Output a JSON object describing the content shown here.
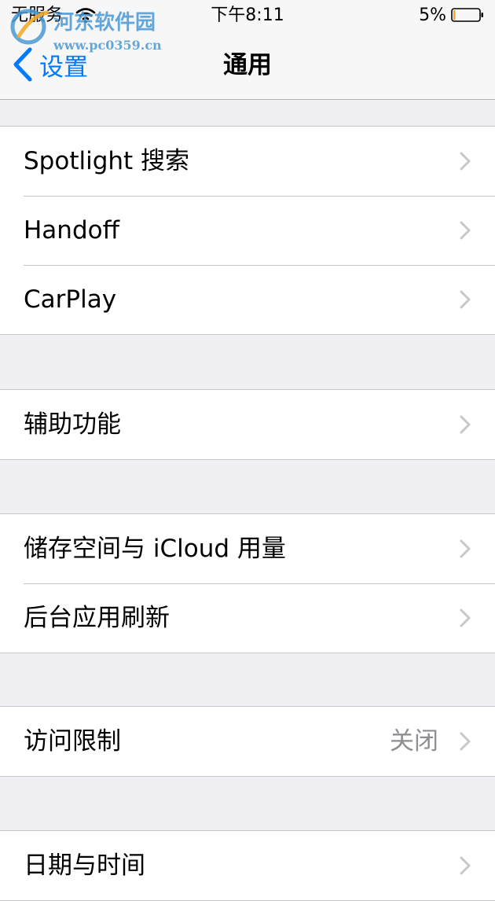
{
  "status_bar": {
    "carrier": "无服务",
    "time": "下午8:11",
    "battery_percent": "5%",
    "icons": [
      "wifi-icon",
      "battery-icon"
    ]
  },
  "watermark": {
    "name": "河东软件园",
    "url": "www.pc0359.cn"
  },
  "nav": {
    "back_label": "设置",
    "title": "通用",
    "back_color": "#007aff"
  },
  "groups": [
    {
      "rows": [
        {
          "label": "Spotlight 搜索",
          "value": ""
        },
        {
          "label": "Handoff",
          "value": ""
        },
        {
          "label": "CarPlay",
          "value": ""
        }
      ]
    },
    {
      "rows": [
        {
          "label": "辅助功能",
          "value": ""
        }
      ]
    },
    {
      "rows": [
        {
          "label": "储存空间与 iCloud 用量",
          "value": ""
        },
        {
          "label": "后台应用刷新",
          "value": ""
        }
      ]
    },
    {
      "rows": [
        {
          "label": "访问限制",
          "value": "关闭"
        }
      ]
    },
    {
      "rows": [
        {
          "label": "日期与时间",
          "value": ""
        }
      ]
    }
  ]
}
